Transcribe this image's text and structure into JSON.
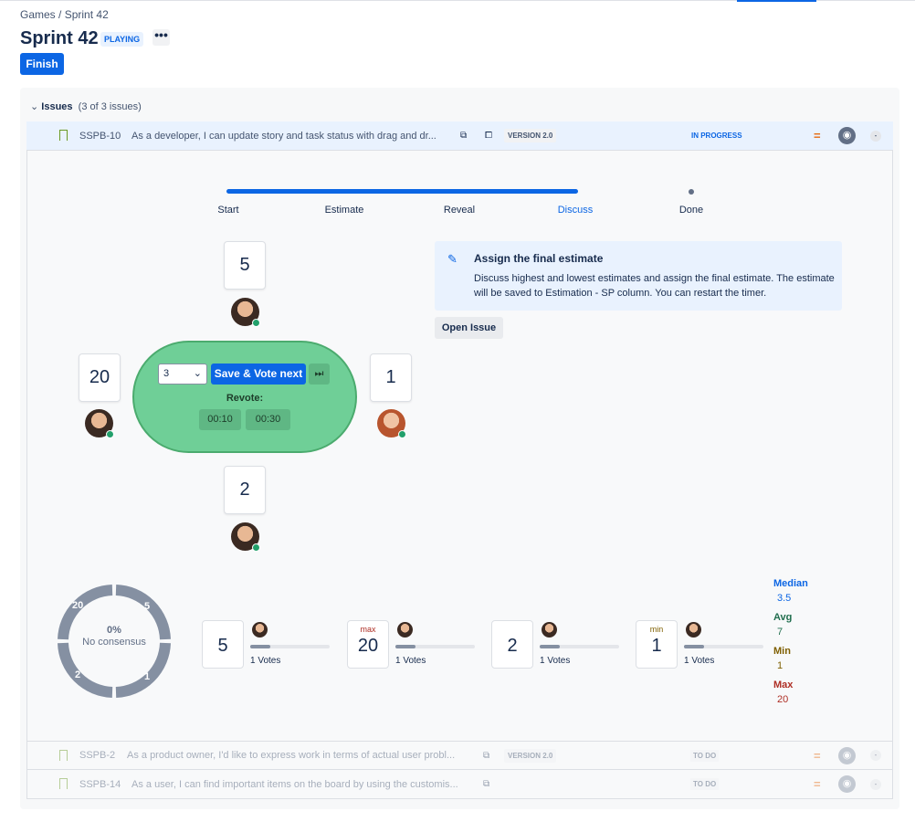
{
  "breadcrumb": {
    "games": "Games",
    "sep": "/",
    "current": "Sprint 42"
  },
  "header": {
    "title": "Sprint 42",
    "status": "PLAYING",
    "more": "•••",
    "finish": "Finish"
  },
  "issues": {
    "label": "Issues",
    "count": "(3 of 3 issues)"
  },
  "rows": [
    {
      "key": "SSPB-10",
      "summary": "As a developer, I can update story and task status with drag and dr...",
      "version": "VERSION 2.0",
      "status": "IN PROGRESS",
      "unassigned": "-"
    },
    {
      "key": "SSPB-2",
      "summary": "As a product owner, I'd like to express work in terms of actual user probl...",
      "version": "VERSION 2.0",
      "status": "TO DO",
      "unassigned": "-"
    },
    {
      "key": "SSPB-14",
      "summary": "As a user, I can find important items on the board by using the customis...",
      "status": "TO DO",
      "unassigned": "-"
    }
  ],
  "steps": [
    "Start",
    "Estimate",
    "Reveal",
    "Discuss",
    "Done"
  ],
  "active_step": "Discuss",
  "players": [
    {
      "vote": "5"
    },
    {
      "vote": "20"
    },
    {
      "vote": "1"
    },
    {
      "vote": "2"
    }
  ],
  "table": {
    "selected": "3",
    "save": "Save & Vote next",
    "revote": "Revote:",
    "timers": [
      "00:10",
      "00:30"
    ]
  },
  "info": {
    "title": "Assign the final estimate",
    "text": "Discuss highest and lowest estimates and assign the final estimate. The estimate will be saved to Estimation - SP column. You can restart the timer.",
    "open_issue": "Open Issue"
  },
  "donut": {
    "percent": "0%",
    "label": "No consensus",
    "segments": [
      "5",
      "1",
      "2",
      "20"
    ]
  },
  "results": [
    {
      "value": "5",
      "tag": "",
      "votes": "1 Votes",
      "fraction": 0.25
    },
    {
      "value": "20",
      "tag": "max",
      "votes": "1 Votes",
      "fraction": 0.25
    },
    {
      "value": "2",
      "tag": "",
      "votes": "1 Votes",
      "fraction": 0.25
    },
    {
      "value": "1",
      "tag": "min",
      "votes": "1 Votes",
      "fraction": 0.25
    }
  ],
  "stats": {
    "median_label": "Median",
    "median": "3.5",
    "avg_label": "Avg",
    "avg": "7",
    "min_label": "Min",
    "min": "1",
    "max_label": "Max",
    "max": "20"
  }
}
